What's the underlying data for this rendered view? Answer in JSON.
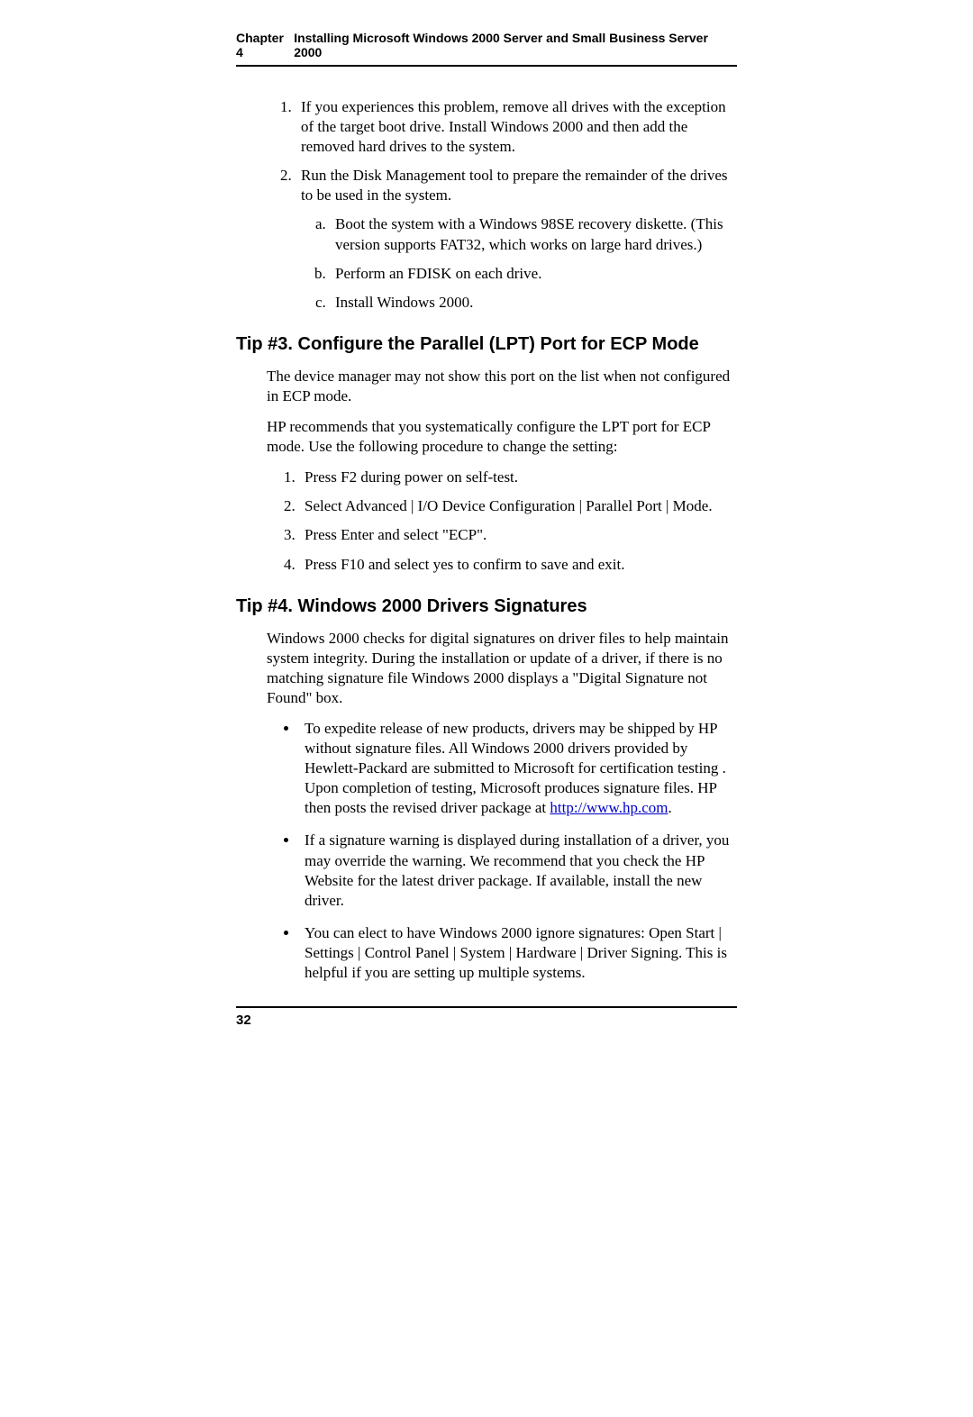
{
  "header": {
    "chapter": "Chapter 4",
    "title": "Installing Microsoft Windows 2000 Server and Small Business Server 2000"
  },
  "section1": {
    "item1": "If you experiences this problem, remove all drives with the exception of the target boot drive. Install Windows 2000 and then add the removed hard drives to the system.",
    "item2": "Run the Disk Management tool to prepare the remainder of the drives to be used in the system.",
    "sub_a": "Boot the system with a Windows 98SE recovery diskette. (This version supports FAT32, which works on large hard drives.)",
    "sub_b": "Perform an FDISK on each drive.",
    "sub_c": "Install Windows 2000."
  },
  "tip3": {
    "heading": "Tip #3. Configure the Parallel (LPT) Port for ECP Mode",
    "p1": "The device manager may not show this port on the list when not configured in ECP mode.",
    "p2": "HP recommends that you systematically configure the LPT port for ECP mode. Use the following procedure to change the setting:",
    "step1": "Press F2 during power on self-test.",
    "step2": "Select Advanced | I/O Device Configuration | Parallel Port | Mode.",
    "step3": "Press Enter and select \"ECP\".",
    "step4": "Press F10 and select yes to confirm to save and exit."
  },
  "tip4": {
    "heading": "Tip #4. Windows 2000 Drivers Signatures",
    "p1": "Windows 2000 checks for digital signatures on driver files to help maintain system integrity.  During the installation or update of a driver, if there is no matching signature file Windows 2000 displays a \"Digital Signature not Found\" box.",
    "b1_pre": "To expedite release of new products, drivers may be shipped by HP without signature files.  All Windows 2000 drivers provided by Hewlett-Packard are submitted to Microsoft for certification testing .  Upon completion of testing, Microsoft produces signature files.  HP then posts the revised driver package at ",
    "b1_link": "http://www.hp.com",
    "b1_post": ".",
    "b2": "If a signature warning is displayed during installation of a driver, you may override the warning.  We recommend that you check the HP Website for the latest driver package. If available, install the new driver.",
    "b3": "You can elect to have Windows 2000 ignore signatures: Open Start | Settings | Control Panel | System | Hardware | Driver Signing.  This is helpful if you are setting up multiple systems."
  },
  "footer": {
    "page_number": "32"
  }
}
